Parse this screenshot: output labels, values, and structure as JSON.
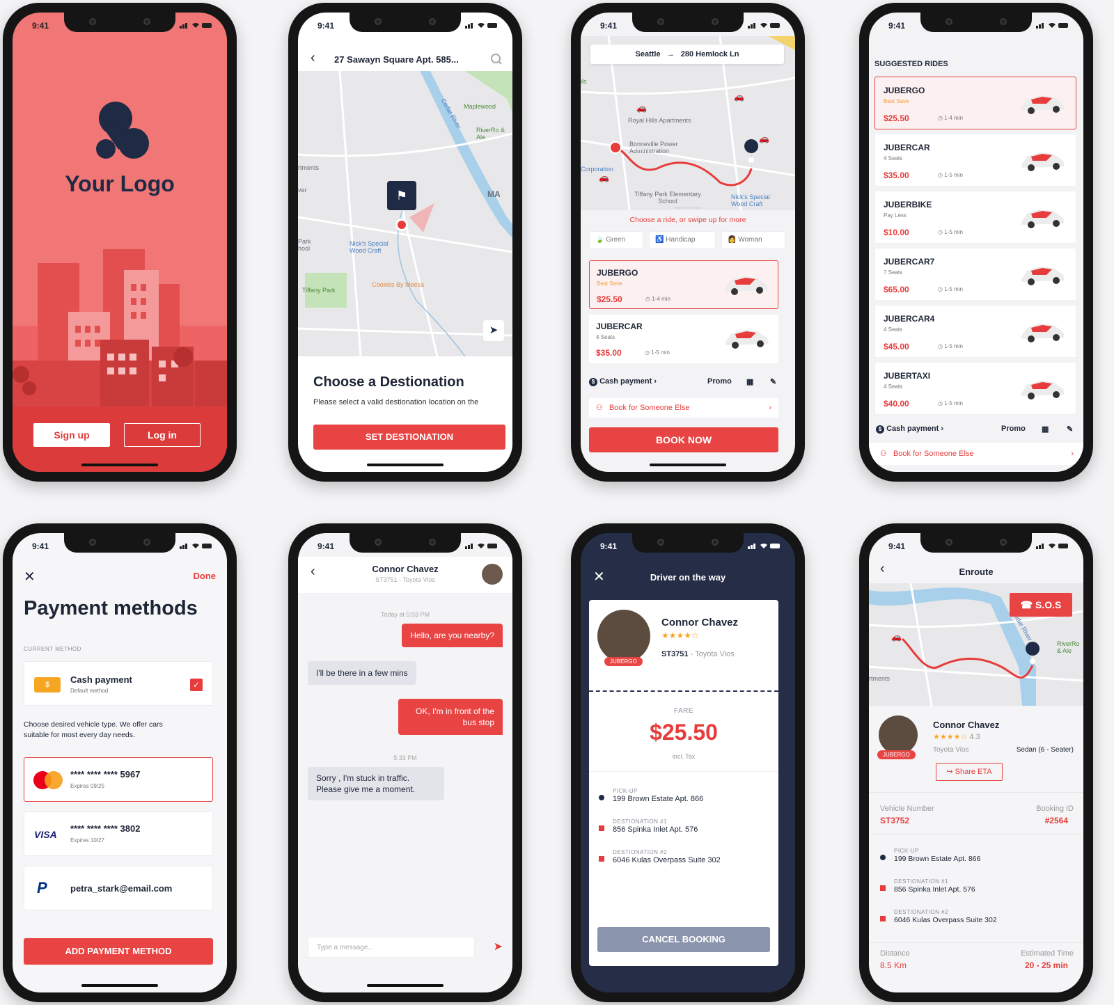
{
  "status_time": "9:41",
  "splash": {
    "logo_text": "Your Logo",
    "signup": "Sign up",
    "login": "Log in"
  },
  "dest": {
    "address": "27 Sawayn Square Apt. 585...",
    "title": "Choose a Destionation",
    "subtitle": "Please select a valid destionation location on the",
    "button": "SET DESTIONATION",
    "map_labels": [
      "Maplewood",
      "RiverRo & Ale",
      "rtments",
      "Park hool",
      "Nick's Special Wood Craft",
      "Tiffany Park",
      "Cookies By Meesa",
      "MA",
      "ver",
      "Cedar River"
    ]
  },
  "route": {
    "from": "Seattle",
    "to": "280 Hemlock Ln",
    "hint": "Choose a ride, or swipe up for more",
    "filters": [
      "Green",
      "Handicap",
      "Woman"
    ],
    "map_labels": [
      "Royal Hills Apartments",
      "Bonneville Power Administration",
      "Corporation",
      "Tiffany Park Elementary School",
      "Nick's Special Wood Craft",
      "ils"
    ],
    "rides": [
      {
        "name": "JUBERGO",
        "sub": "Best Save",
        "price": "$25.50",
        "eta": "1-4 min"
      },
      {
        "name": "JUBERCAR",
        "sub": "4 Seats",
        "price": "$35.00",
        "eta": "1-5 min"
      }
    ],
    "payment": "Cash payment",
    "promo": "Promo",
    "book_someone": "Book for Someone Else",
    "book_now": "BOOK NOW"
  },
  "suggested": {
    "title": "SUGGESTED RIDES",
    "rides": [
      {
        "name": "JUBERGO",
        "sub": "Best Save",
        "price": "$25.50",
        "eta": "1-4 min"
      },
      {
        "name": "JUBERCAR",
        "sub": "4 Seats",
        "price": "$35.00",
        "eta": "1-5 min"
      },
      {
        "name": "JUBERBIKE",
        "sub": "Pay Less",
        "price": "$10.00",
        "eta": "1-5 min"
      },
      {
        "name": "JUBERCAR7",
        "sub": "7 Seats",
        "price": "$65.00",
        "eta": "1-5 min"
      },
      {
        "name": "JUBERCAR4",
        "sub": "4 Seats",
        "price": "$45.00",
        "eta": "1-5 min"
      },
      {
        "name": "JUBERTAXI",
        "sub": "4 Seats",
        "price": "$40.00",
        "eta": "1-5 min"
      }
    ],
    "payment": "Cash payment",
    "promo": "Promo",
    "book_someone": "Book for Someone Else"
  },
  "payment": {
    "done": "Done",
    "title": "Payment methods",
    "current_label": "CURRENT METHOD",
    "current_name": "Cash payment",
    "current_sub": "Default method",
    "desc": "Choose desired vehicle type. We offer cars suitable for most every day needs.",
    "cards": [
      {
        "number": "**** **** **** 5967",
        "exp": "Expires 09/25"
      },
      {
        "number": "**** **** **** 3802",
        "exp": "Expires 10/27",
        "brand": "VISA"
      }
    ],
    "paypal_email": "petra_stark@email.com",
    "add": "ADD PAYMENT METHOD"
  },
  "chat": {
    "name": "Connor Chavez",
    "sub": "ST3751 - Toyota Vios",
    "ts1": "Today at 5:03 PM",
    "m1": "Hello, are you nearby?",
    "m2": "I'll be there in a few mins",
    "m3": "OK, I'm in front of the bus stop",
    "ts2": "5:33 PM",
    "m4": "Sorry , I'm stuck in traffic. Please give me a moment.",
    "placeholder": "Type a message..."
  },
  "driver": {
    "header": "Driver on the way",
    "name": "Connor Chavez",
    "badge": "JUBERGO",
    "plate": "ST3751",
    "car": "- Toyota Vios",
    "fare_label": "FARE",
    "fare": "$25.50",
    "tax": "incl. Tax",
    "stops": [
      {
        "label": "PICK-UP",
        "addr": "199 Brown Estate Apt. 866"
      },
      {
        "label": "DESTIONATION #1",
        "addr": "856 Spinka Inlet Apt. 576"
      },
      {
        "label": "DESTIONATION #2",
        "addr": "6046 Kulas Overpass Suite 302"
      }
    ],
    "cancel": "CANCEL BOOKING"
  },
  "enroute": {
    "title": "Enroute",
    "sos": "S.O.S",
    "name": "Connor Chavez",
    "rating": "4.3",
    "badge": "JUBERGO",
    "car": "Toyota Vios",
    "car_type": "Sedan (6 - Seater)",
    "share": "Share ETA",
    "vehicle_label": "Vehicle Number",
    "vehicle": "ST3752",
    "booking_label": "Booking ID",
    "booking": "#2564",
    "stops": [
      {
        "label": "PICK-UP",
        "addr": "199 Brown Estate Apt. 866"
      },
      {
        "label": "DESTIONATION #1",
        "addr": "856 Spinka Inlet Apt. 576"
      },
      {
        "label": "DESTIONATION #2",
        "addr": "6046 Kulas Overpass Suite 302"
      }
    ],
    "distance_label": "Distance",
    "distance": "8.5 Km",
    "time_label": "Estimated Time",
    "time": "20 - 25 min",
    "map_labels": [
      "RiverRo & Ale",
      "rtments",
      "Cedar River"
    ]
  }
}
